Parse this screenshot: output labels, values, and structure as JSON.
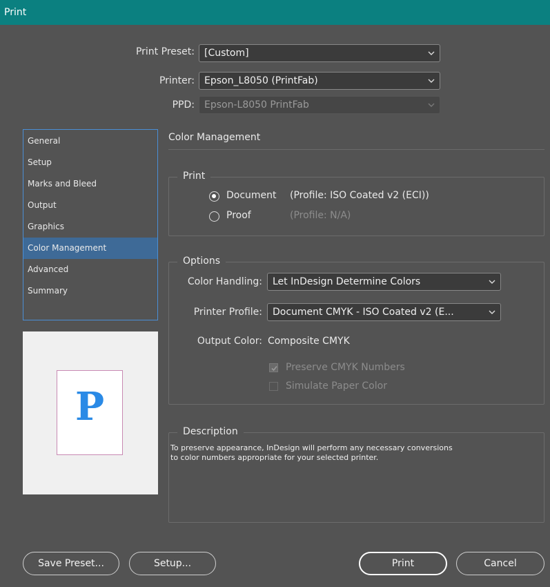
{
  "window": {
    "title": "Print"
  },
  "top": {
    "preset_label": "Print Preset:",
    "preset_value": "[Custom]",
    "printer_label": "Printer:",
    "printer_value": "Epson_L8050 (PrintFab)",
    "ppd_label": "PPD:",
    "ppd_value": "Epson-L8050 PrintFab"
  },
  "sidebar": {
    "items": [
      {
        "label": "General"
      },
      {
        "label": "Setup"
      },
      {
        "label": "Marks and Bleed"
      },
      {
        "label": "Output"
      },
      {
        "label": "Graphics"
      },
      {
        "label": "Color Management"
      },
      {
        "label": "Advanced"
      },
      {
        "label": "Summary"
      }
    ],
    "active": "Color Management"
  },
  "preview": {
    "letter": "P"
  },
  "main": {
    "title": "Color Management",
    "print_group": {
      "title": "Print",
      "document_label": "Document",
      "document_profile": "(Profile: ISO Coated v2 (ECI))",
      "proof_label": "Proof",
      "proof_profile": "(Profile: N/A)",
      "selected": "Document"
    },
    "options_group": {
      "title": "Options",
      "color_handling_label": "Color Handling:",
      "color_handling_value": "Let InDesign Determine Colors",
      "printer_profile_label": "Printer Profile:",
      "printer_profile_value": "Document CMYK - ISO Coated v2 (E...",
      "output_color_label": "Output Color:",
      "output_color_value": "Composite CMYK",
      "preserve_cmyk_label": "Preserve CMYK Numbers",
      "preserve_cmyk_checked": true,
      "simulate_paper_label": "Simulate Paper Color",
      "simulate_paper_checked": false
    },
    "description_group": {
      "title": "Description",
      "line1": "To preserve appearance, InDesign will perform any necessary conversions",
      "line2": "to color numbers appropriate for your selected printer."
    }
  },
  "buttons": {
    "save_preset": "Save Preset...",
    "setup": "Setup...",
    "print": "Print",
    "cancel": "Cancel"
  },
  "colors": {
    "titlebar": "#0b8080",
    "background": "#535353",
    "selection": "#3e6a97",
    "focus": "#4a8fd6"
  }
}
